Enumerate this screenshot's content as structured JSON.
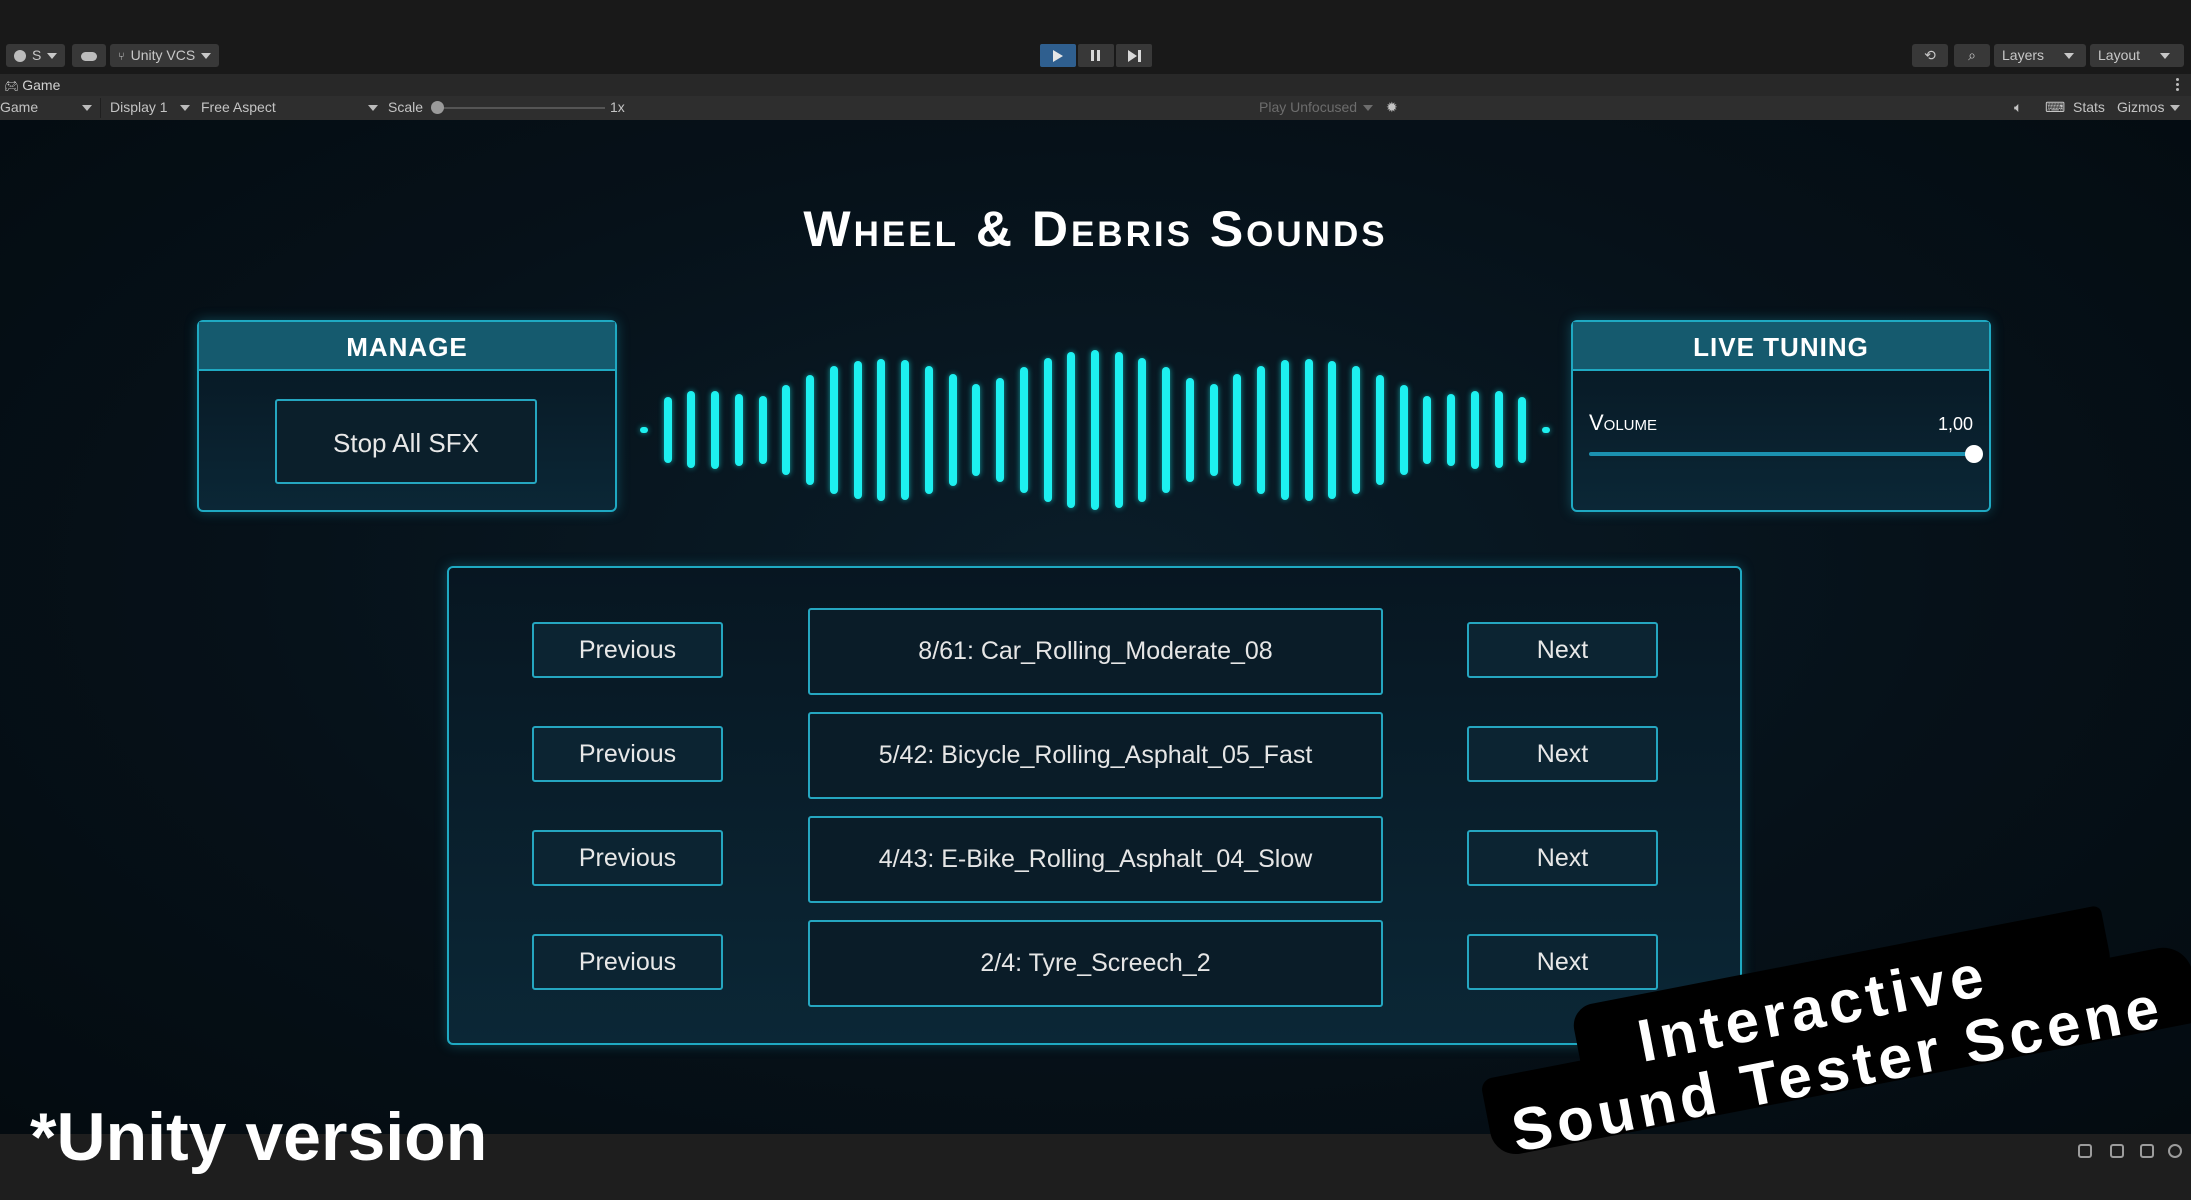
{
  "editor": {
    "account_label": "S",
    "vcs_label": "Unity VCS",
    "layers_label": "Layers",
    "layout_label": "Layout",
    "tab_label": "Game",
    "view_mode": "Game",
    "display": "Display 1",
    "aspect": "Free Aspect",
    "scale_label": "Scale",
    "scale_value": "1x",
    "play_focus": "Play Unfocused",
    "stats_label": "Stats",
    "gizmos_label": "Gizmos"
  },
  "scene": {
    "title": "Wheel & Debris Sounds",
    "manage": {
      "header": "MANAGE",
      "stop_button": "Stop All SFX"
    },
    "live_tuning": {
      "header": "LIVE TUNING",
      "volume_label": "Volume",
      "volume_value": "1,00",
      "volume_level": 1.0
    },
    "rows": [
      {
        "prev": "Previous",
        "sound": "8/61: Car_Rolling_Moderate_08",
        "next": "Next"
      },
      {
        "prev": "Previous",
        "sound": "5/42: Bicycle_Rolling_Asphalt_05_Fast",
        "next": "Next"
      },
      {
        "prev": "Previous",
        "sound": "4/43: E-Bike_Rolling_Asphalt_04_Slow",
        "next": "Next"
      },
      {
        "prev": "Previous",
        "sound": "2/4: Tyre_Screech_2",
        "next": "Next"
      }
    ]
  },
  "overlay": {
    "unity_note": "*Unity version",
    "promo_line1": "Interactive",
    "promo_line2": "Sound Tester Scene"
  },
  "colors": {
    "accent": "#1fa9c2",
    "wave": "#1df0f0",
    "panel_header": "#155a6e",
    "play_active": "#2f5f8f"
  }
}
